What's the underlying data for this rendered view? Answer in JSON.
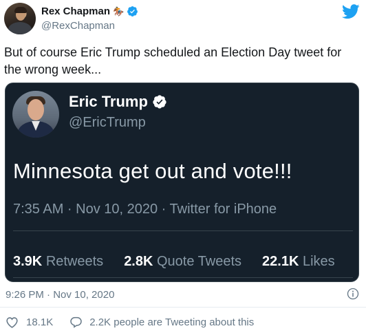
{
  "author": {
    "display_name": "Rex Chapman",
    "name_emoji": "🏇",
    "handle": "@RexChapman"
  },
  "tweet": {
    "text": "But of course Eric Trump scheduled an Election Day tweet for the wrong week..."
  },
  "quoted_tweet": {
    "display_name": "Eric Trump",
    "handle": "@EricTrump",
    "text": "Minnesota get out and vote!!!",
    "meta": "7:35 AM · Nov 10, 2020 · Twitter for iPhone",
    "stats": [
      {
        "value": "3.9K",
        "label": "Retweets"
      },
      {
        "value": "2.8K",
        "label": "Quote Tweets"
      },
      {
        "value": "22.1K",
        "label": "Likes"
      }
    ]
  },
  "footer": {
    "timestamp": "9:26 PM · Nov 10, 2020",
    "likes": "18.1K",
    "conversation": "2.2K people are Tweeting about this"
  },
  "colors": {
    "twitter_blue": "#1da1f2",
    "quote_background": "#15202b",
    "secondary_text": "#657786"
  },
  "icons": [
    "verified-icon",
    "twitter-bird-icon",
    "info-icon",
    "heart-icon",
    "reply-icon"
  ]
}
